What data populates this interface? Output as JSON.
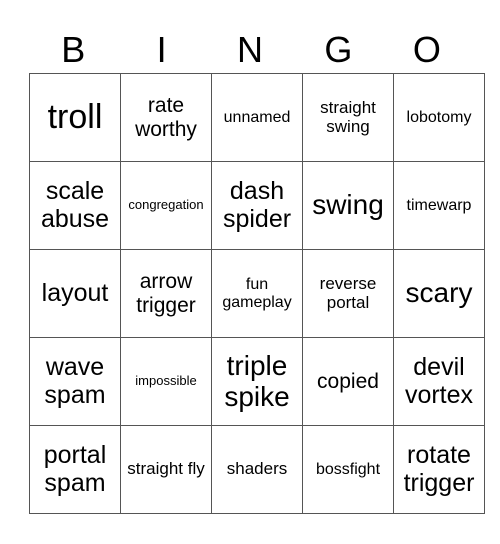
{
  "header": [
    "B",
    "I",
    "N",
    "G",
    "O"
  ],
  "rows": [
    [
      "troll",
      "rate worthy",
      "unnamed",
      "straight swing",
      "lobotomy"
    ],
    [
      "scale abuse",
      "congregation",
      "dash spider",
      "swing",
      "timewarp"
    ],
    [
      "layout",
      "arrow trigger",
      "fun gameplay",
      "reverse portal",
      "scary"
    ],
    [
      "wave spam",
      "impossible",
      "triple spike",
      "copied",
      "devil vortex"
    ],
    [
      "portal spam",
      "straight fly",
      "shaders",
      "bossfight",
      "rotate trigger"
    ]
  ]
}
